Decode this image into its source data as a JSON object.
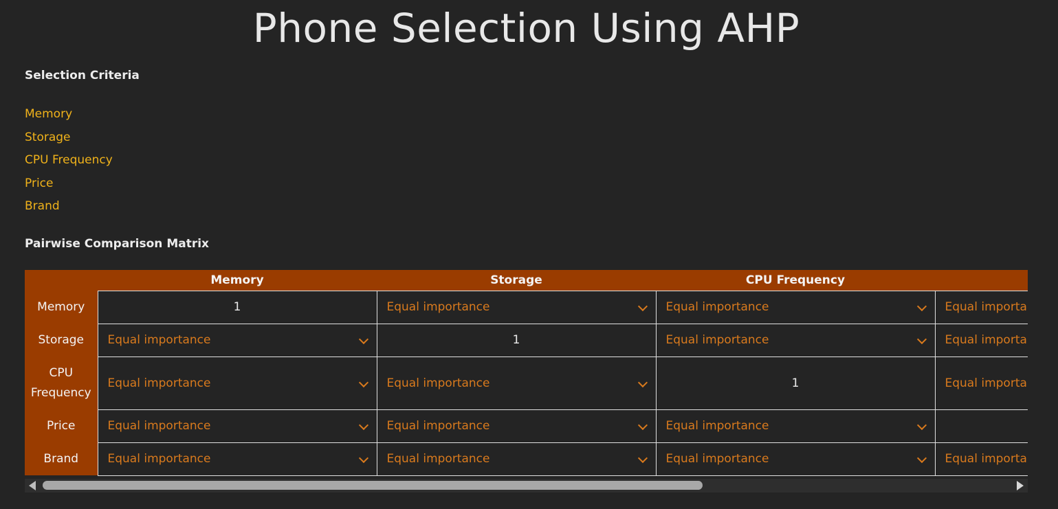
{
  "title": "Phone Selection Using AHP",
  "criteria_heading": "Selection Criteria",
  "criteria": [
    "Memory",
    "Storage",
    "CPU Frequency",
    "Price",
    "Brand"
  ],
  "matrix_heading": "Pairwise Comparison Matrix",
  "matrix": {
    "columns": [
      "Memory",
      "Storage",
      "CPU Frequency",
      ""
    ],
    "rows": [
      {
        "label": "Memory",
        "cells": [
          "1",
          "Equal importance",
          "Equal importance",
          "Equal importance"
        ]
      },
      {
        "label": "Storage",
        "cells": [
          "Equal importance",
          "1",
          "Equal importance",
          "Equal importance"
        ]
      },
      {
        "label": "CPU Frequency",
        "cells": [
          "Equal importance",
          "Equal importance",
          "1",
          "Equal importance"
        ]
      },
      {
        "label": "Price",
        "cells": [
          "Equal importance",
          "Equal importance",
          "Equal importance",
          ""
        ]
      },
      {
        "label": "Brand",
        "cells": [
          "Equal importance",
          "Equal importance",
          "Equal importance",
          "Equal importance"
        ]
      }
    ]
  },
  "colors": {
    "background": "#242424",
    "header_fill": "#9a3c00",
    "criteria_text": "#f0b21a",
    "dropdown_text": "#d97a1d"
  },
  "icons": {
    "dropdown": "chevron-down-icon",
    "scroll_left": "arrow-left-icon",
    "scroll_right": "arrow-right-icon"
  }
}
